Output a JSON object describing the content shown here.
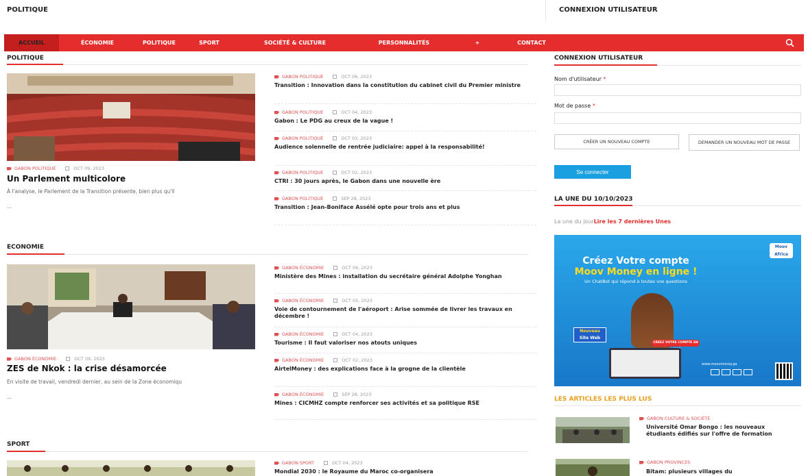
{
  "top": {
    "left_title": "POLITIQUE",
    "right_title": "CONNEXION UTILISATEUR"
  },
  "nav": {
    "items": [
      {
        "label": "ACCUEIL",
        "active": true
      },
      {
        "label": "ÉCONOMIE",
        "active": false
      },
      {
        "label": "POLITIQUE",
        "active": false
      },
      {
        "label": "SPORT",
        "active": false
      },
      {
        "label": "SOCIÉTÉ & CULTURE",
        "active": false
      },
      {
        "label": "PERSONNALITÉS",
        "active": false
      },
      {
        "label": "+",
        "active": false
      },
      {
        "label": "CONTACT",
        "active": false
      }
    ],
    "search_icon": "search-icon",
    "accent_color": "#e52d2d"
  },
  "sections": [
    {
      "title": "POLITIQUE",
      "lead": {
        "category": "GABON POLITIQUE",
        "date": "OCT 09, 2023",
        "title": "Un Parlement multicolore",
        "excerpt": "À l'analyse, le Parlement de la Transition présente, bien plus qu'il",
        "ellipsis": "..."
      },
      "items": [
        {
          "category": "GABON POLITIQUE",
          "date": "OCT 06, 2023",
          "title": "Transition : Innovation dans la constitution du cabinet civil du Premier ministre"
        },
        {
          "category": "GABON POLITIQUE",
          "date": "OCT 04, 2023",
          "title": "Gabon : Le PDG au creux de la vague !"
        },
        {
          "category": "GABON POLITIQUE",
          "date": "OCT 03, 2023",
          "title": "Audience solennelle de rentrée judiciaire: appel à la responsabilité!"
        },
        {
          "category": "GABON POLITIQUE",
          "date": "OCT 02, 2023",
          "title": "CTRI : 30 jours après, le Gabon dans une nouvelle ère"
        },
        {
          "category": "GABON POLITIQUE",
          "date": "SEP 28, 2023",
          "title": "Transition : Jean-Boniface Assélé opte pour trois ans et plus"
        }
      ]
    },
    {
      "title": "ECONOMIE",
      "lead": {
        "category": "GABON ÉCONOMIE",
        "date": "OCT 09, 2023",
        "title": "ZES de Nkok : la crise désamorcée",
        "excerpt": "En visite de travail, vendredi dernier, au sein de la Zone économiqu",
        "ellipsis": "..."
      },
      "items": [
        {
          "category": "GABON ÉCONOMIE",
          "date": "OCT 06, 2023",
          "title": "Ministère des Mines : installation du secrétaire général Adolphe Yonghan"
        },
        {
          "category": "GABON ÉCONOMIE",
          "date": "OCT 05, 2023",
          "title": "Voie de contournement de l'aéroport : Arise sommée de livrer les travaux en décembre !"
        },
        {
          "category": "GABON ÉCONOMIE",
          "date": "OCT 04, 2023",
          "title": "Tourisme : Il faut valoriser nos atouts uniques"
        },
        {
          "category": "GABON ÉCONOMIE",
          "date": "OCT 02, 2023",
          "title": "AirtelMoney : des explications face à la grogne de la clientèle"
        },
        {
          "category": "GABON ÉCONOMIE",
          "date": "SEP 28, 2023",
          "title": "Mines : CICMHZ compte renforcer ses activités et sa politique RSE"
        }
      ]
    },
    {
      "title": "SPORT",
      "items": [
        {
          "category": "GABON SPORT",
          "date": "OCT 04, 2023",
          "title": "Mondial 2030 : le Royaume du Maroc co-organisera"
        }
      ]
    }
  ],
  "sidebar": {
    "login": {
      "title": "CONNEXION UTILISATEUR",
      "username_label": "Nom d'utilisateur",
      "password_label": "Mot de passe",
      "required_mark": "*",
      "username_value": "",
      "password_value": "",
      "create_account": "CRÉER UN NOUVEAU COMPTE",
      "request_password": "DEMANDER UN NOUVEAU MOT DE PASSE",
      "submit": "Se connecter",
      "submit_color": "#1a9fe0"
    },
    "une": {
      "title": "LA UNE DU 10/10/2023",
      "text": "La une du jour",
      "link": "Lire les 7 dernières Unes"
    },
    "ad": {
      "logo": "Moov Africa",
      "headline1": "Créez Votre compte",
      "headline2": "Moov Money en ligne !",
      "subline": "Un ChatBot qui répond à toutes vos questions",
      "badge1": "Nouveau",
      "badge2": "Site Web",
      "cta": "CRÉEZ VOTRE COMPTE EN LIGNE",
      "url": "www.moovmoney.ga"
    },
    "most_read": {
      "title": "LES ARTICLES LES PLUS LUS",
      "title_color": "#e8a020",
      "items": [
        {
          "category": "GABON CULTURE & SOCIÉTÉ",
          "title": "Université Omar Bongo : les nouveaux étudiants édifiés sur l'offre de formation"
        },
        {
          "category": "GABON PROVINCES",
          "title": "Bitam: plusieurs villages du"
        }
      ]
    }
  }
}
